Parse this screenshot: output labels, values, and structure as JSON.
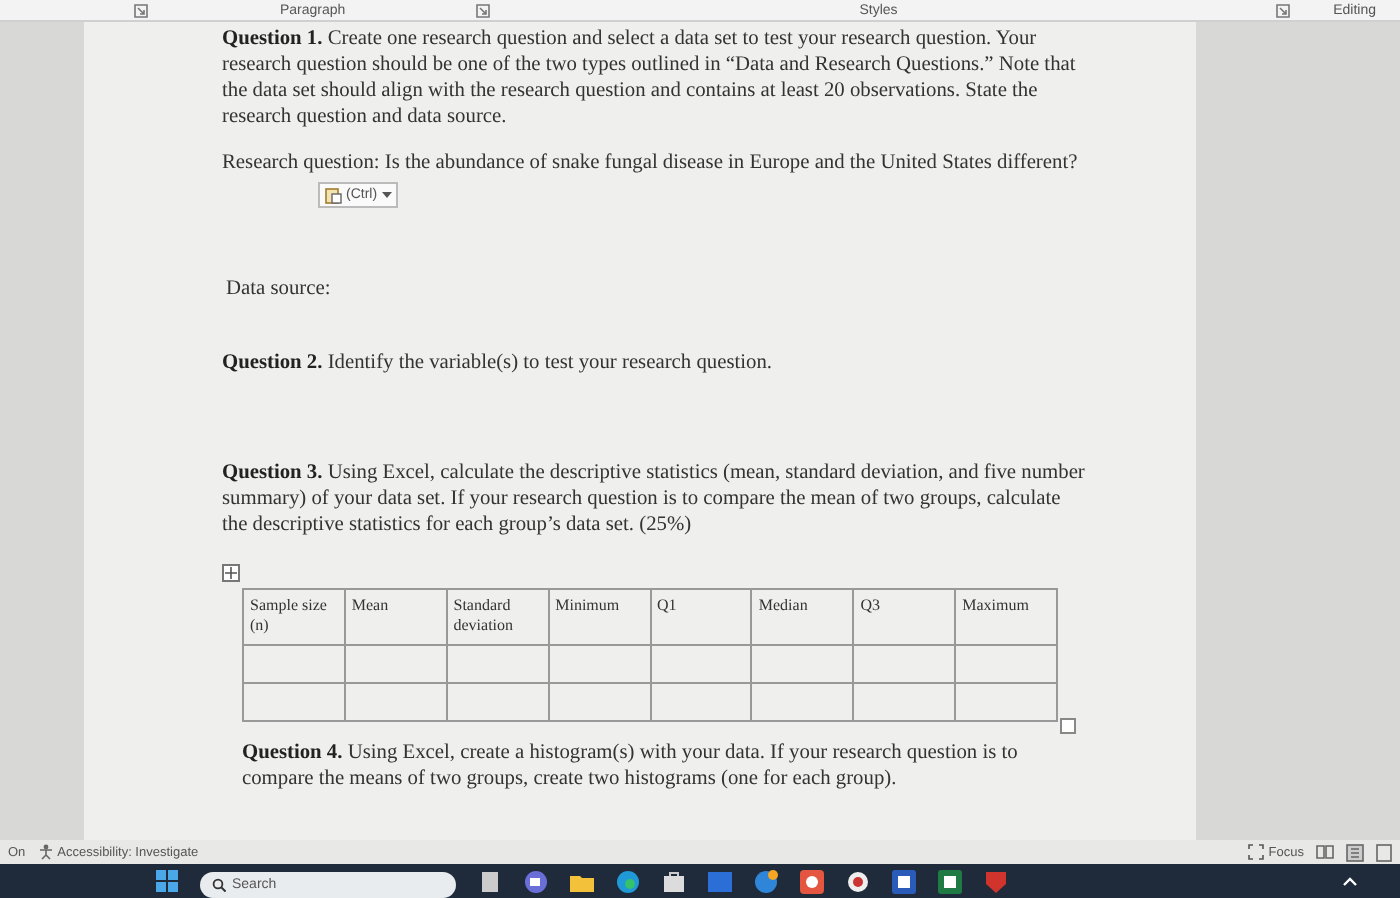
{
  "ribbon": {
    "groups": [
      {
        "label": "Paragraph"
      },
      {
        "label": "Styles"
      },
      {
        "label": "Editing"
      }
    ]
  },
  "document": {
    "question_1": "**Question 1.** Create one research question and select a data set to test your research question. Your research question should be one of the two types outlined in “Data and Research Questions.” Note that the data set should align with the research question and contains at least 20 observations. State the research question and data source.",
    "research_question": "Research question: Is the abundance of snake fungal disease in Europe and the United States different?",
    "paste_options": "(Ctrl)",
    "data_source": "Data source:",
    "question_2": "**Question 2.** Identify the variable(s) to test your research question.",
    "question_3": "**Question 3.** Using Excel, calculate the descriptive statistics (mean, standard deviation, and five number summary) of your data set. If your research question is to compare the mean of two groups, calculate the descriptive statistics for each group’s data set. (25%)",
    "table": {
      "columns": [
        "Sample size (n)",
        "Mean",
        "Standard deviation",
        "Minimum",
        "Q1",
        "Median",
        "Q3",
        "Maximum"
      ]
    },
    "question_4": "**Question 4.** Using Excel, create a histogram(s) with your data. If your research question is to compare the means of two groups, create two histograms (one for each group)."
  },
  "status_bar": {
    "left": "On",
    "accessibility": "Accessibility: Investigate",
    "focus": "Focus"
  },
  "taskbar": {
    "search": {
      "placeholder": "Search"
    }
  }
}
